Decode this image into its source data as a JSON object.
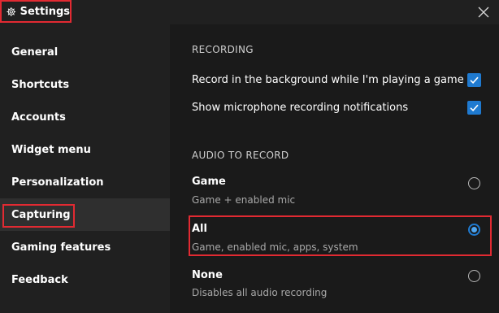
{
  "window": {
    "title": "Settings",
    "icons": {
      "title": "gear-icon",
      "close": "close-icon"
    }
  },
  "sidebar": {
    "items": [
      {
        "label": "General"
      },
      {
        "label": "Shortcuts"
      },
      {
        "label": "Accounts"
      },
      {
        "label": "Widget menu"
      },
      {
        "label": "Personalization"
      },
      {
        "label": "Capturing",
        "selected": true
      },
      {
        "label": "Gaming features"
      },
      {
        "label": "Feedback"
      }
    ]
  },
  "recording": {
    "heading": "RECORDING",
    "options": [
      {
        "label": "Record in the background while I'm playing a game",
        "checked": true
      },
      {
        "label": "Show microphone recording notifications",
        "checked": true
      }
    ]
  },
  "audio": {
    "heading": "AUDIO TO RECORD",
    "options": [
      {
        "title": "Game",
        "subtitle": "Game + enabled mic",
        "selected": false
      },
      {
        "title": "All",
        "subtitle": "Game, enabled mic, apps, system",
        "selected": true
      },
      {
        "title": "None",
        "subtitle": "Disables all audio recording",
        "selected": false
      }
    ]
  },
  "colors": {
    "accent": "#1f7ad0",
    "highlight_outline": "#e22a32",
    "sidebar_bg": "#202020",
    "content_bg": "#1a1a1a",
    "selected_nav_bg": "#2f2f2f"
  }
}
